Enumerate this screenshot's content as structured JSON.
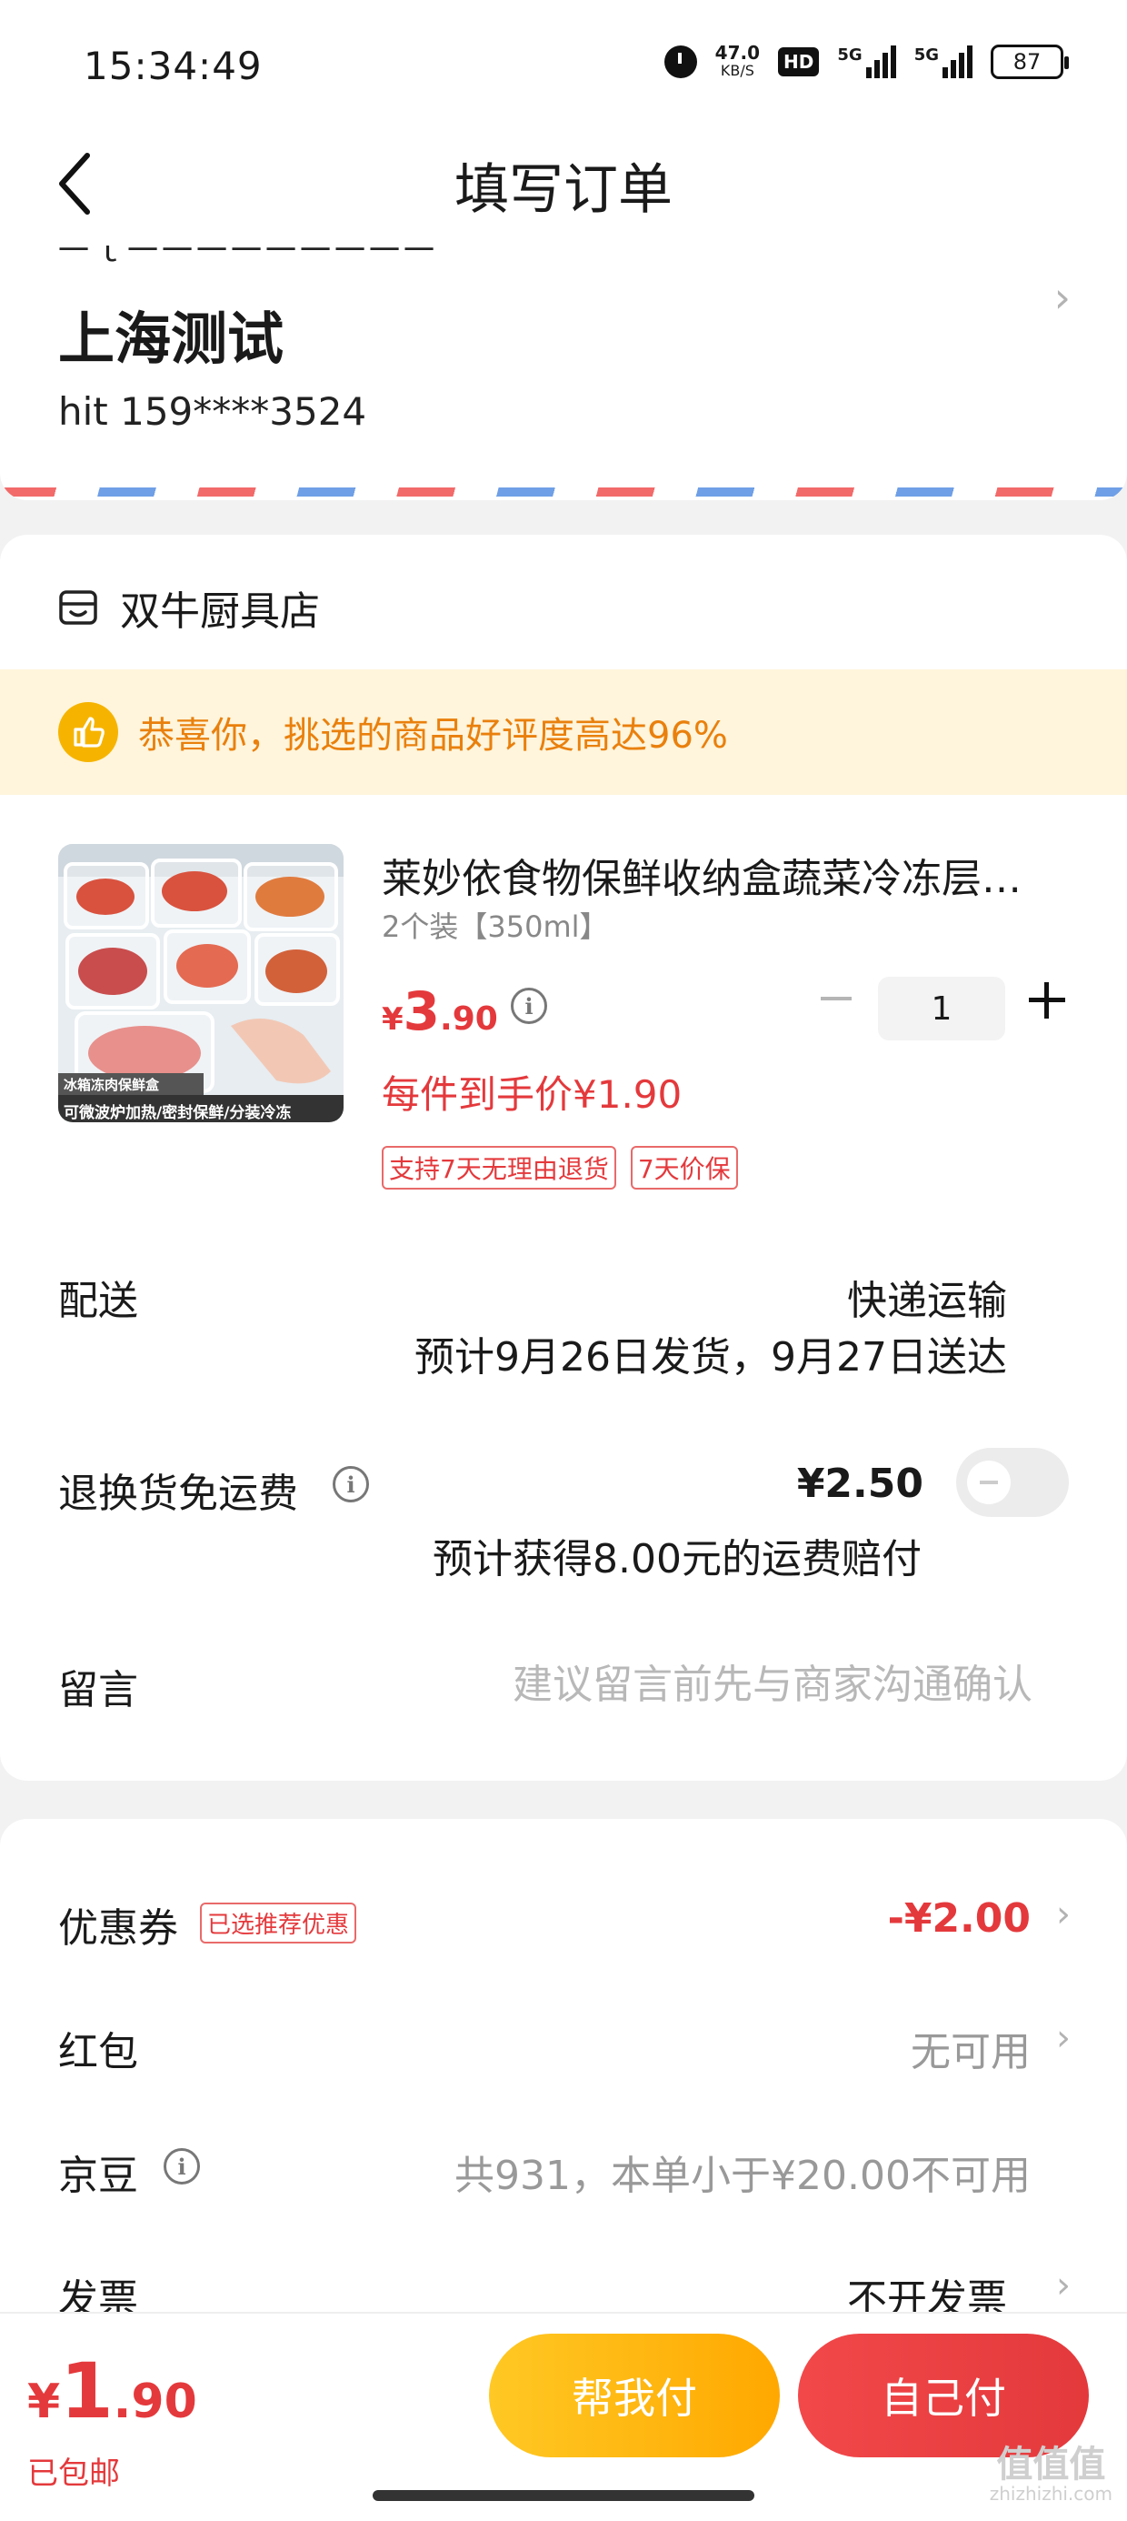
{
  "status_bar": {
    "time": "15:34:49",
    "net_speed": "47.0",
    "net_unit": "KB/S",
    "hd": "HD",
    "sim1": "5G",
    "sim2": "5G",
    "battery": "87"
  },
  "nav": {
    "title": "填写订单"
  },
  "address": {
    "name": "上海测试",
    "contact": "hit  159****3524",
    "cut_line": "一ｌ一一一一一一一一一"
  },
  "shop": {
    "name": "双牛厨具店",
    "praise": "恭喜你，挑选的商品好评度高达96%"
  },
  "product": {
    "title": "莱妙依食物保鲜收纳盒蔬菜冷冻层冰箱冻肉保鲜盒",
    "spec": "2个装【350ml】",
    "price_currency": "¥",
    "price_int": "3",
    "price_dec": ".90",
    "quantity": "1",
    "unit_price": "每件到手价¥1.90",
    "tags": [
      "支持7天无理由退货",
      "7天价保"
    ],
    "image_caption_top": "冰箱冻肉保鲜盒",
    "image_caption_bottom": "可微波炉加热/密封保鲜/分装冷冻"
  },
  "delivery": {
    "label": "配送",
    "method": "快递运输",
    "eta": "预计9月26日发货，9月27日送达"
  },
  "return_insurance": {
    "label": "退换货免运费",
    "price": "¥2.50",
    "note": "预计获得8.00元的运费赔付",
    "enabled": false
  },
  "message": {
    "label": "留言",
    "placeholder": "建议留言前先与商家沟通确认"
  },
  "coupon": {
    "label": "优惠券",
    "tag": "已选推荐优惠",
    "value": "-¥2.00"
  },
  "red_packet": {
    "label": "红包",
    "value": "无可用"
  },
  "jd_beans": {
    "label": "京豆",
    "value": "共931，本单小于¥20.00不可用"
  },
  "invoice": {
    "label": "发票",
    "value": "不开发票"
  },
  "bottom": {
    "total_currency": "¥",
    "total_int": "1",
    "total_dec": ".90",
    "shipping_note": "已包邮",
    "help_pay": "帮我付",
    "self_pay": "自己付"
  },
  "watermark": {
    "main": "值值值",
    "sub": "zhizhizhi.com"
  },
  "colors": {
    "accent": "#e4393c",
    "help_btn": "#ffb400",
    "praise_bg": "#fff5dc"
  }
}
